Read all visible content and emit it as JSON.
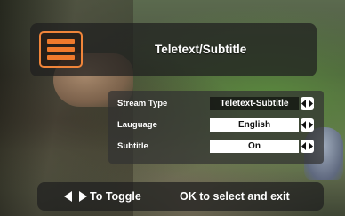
{
  "header": {
    "title": "Teletext/Subtitle",
    "menu_icon": "hamburger-menu-icon",
    "accent": "#ef7a2c"
  },
  "settings": [
    {
      "label": "Stream Type",
      "value": "Teletext-Subtitle"
    },
    {
      "label": "Lauguage",
      "value": "English"
    },
    {
      "label": "Subtitle",
      "value": "On"
    }
  ],
  "footer": {
    "toggle_label": "To Toggle",
    "ok_label": "OK to select and exit",
    "left_icon": "left-arrow-icon",
    "right_icon": "right-arrow-icon"
  }
}
